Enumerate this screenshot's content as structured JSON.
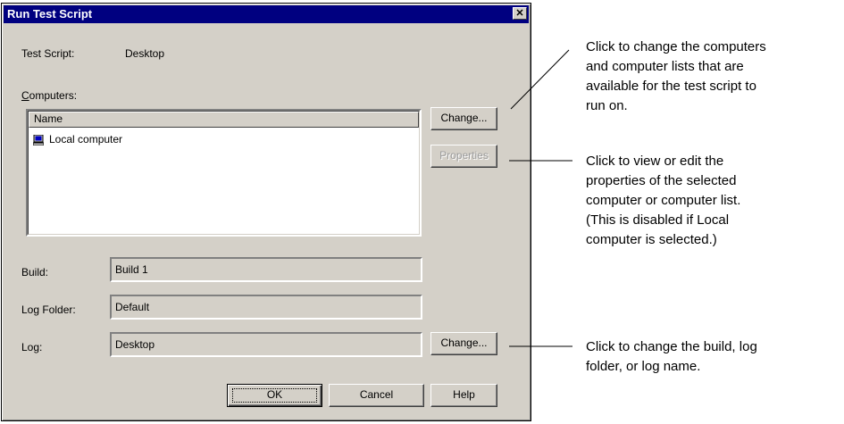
{
  "dialog": {
    "title": "Run Test Script",
    "close_glyph": "✕",
    "test_script_label": "Test Script:",
    "test_script_value": "Desktop",
    "computers_label": "Computers:",
    "list_header": "Name",
    "list_items": [
      {
        "label": "Local computer",
        "icon": "computer-icon"
      }
    ],
    "change_computers_button": "Change...",
    "properties_button": "Properties",
    "build_label": "Build:",
    "build_value": "Build 1",
    "log_folder_label": "Log Folder:",
    "log_folder_value": "Default",
    "log_label": "Log:",
    "log_value": "Desktop",
    "change_log_button": "Change...",
    "ok_button": "OK",
    "cancel_button": "Cancel",
    "help_button": "Help"
  },
  "callouts": {
    "change_computers": [
      "Click to change the computers",
      "and computer lists that are",
      "available for the test script to",
      "run on."
    ],
    "properties": [
      "Click to view or edit the",
      "properties of the selected",
      "computer or computer list.",
      "(This is disabled if Local",
      "computer is selected.)"
    ],
    "change_log": [
      "Click to change the build, log",
      "folder, or log name."
    ]
  },
  "colors": {
    "titlebar": "#000080",
    "face": "#d4d0c8"
  }
}
